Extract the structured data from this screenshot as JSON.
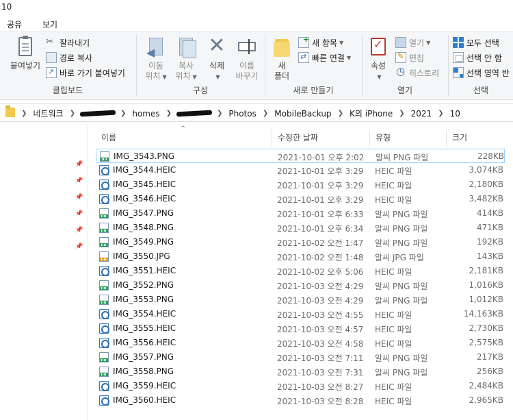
{
  "window": {
    "title": "10"
  },
  "menu": {
    "tabs": [
      "공유",
      "보기"
    ]
  },
  "ribbon": {
    "clipboard": {
      "label": "클립보드",
      "paste": "붙여넣기",
      "cut": "잘라내기",
      "copy_path": "경로 복사",
      "paste_shortcut": "바로 가기 붙여넣기"
    },
    "organize": {
      "label": "구성",
      "move_to": [
        "이동",
        "위치"
      ],
      "copy_to": [
        "복사",
        "위치"
      ],
      "delete": "삭제",
      "rename": [
        "이름",
        "바꾸기"
      ]
    },
    "new": {
      "label": "새로 만들기",
      "new_folder": [
        "새",
        "폴더"
      ],
      "new_item": "새 항목",
      "easy_access": "빠른 연결"
    },
    "open": {
      "label": "열기",
      "properties": "속성",
      "open": "열기",
      "edit": "편집",
      "history": "히스토리"
    },
    "select": {
      "label": "선택",
      "select_all": "모두 선택",
      "select_none": "선택 안 함",
      "invert": "선택 영역 반"
    }
  },
  "address": {
    "crumbs": [
      "네트워크",
      "homes",
      "Photos",
      "MobileBackup",
      "K의 iPhone",
      "2021",
      "10"
    ]
  },
  "columns": {
    "name": "이름",
    "date": "수정한 날짜",
    "type": "유형",
    "size": "크기"
  },
  "files": [
    {
      "name": "IMG_3543.PNG",
      "date": "2021-10-01 오후 2:02",
      "type": "알씨 PNG 파일",
      "size": "228KB",
      "kind": "png"
    },
    {
      "name": "IMG_3544.HEIC",
      "date": "2021-10-01 오후 3:29",
      "type": "HEIC 파일",
      "size": "3,074KB",
      "kind": "heic"
    },
    {
      "name": "IMG_3545.HEIC",
      "date": "2021-10-01 오후 3:29",
      "type": "HEIC 파일",
      "size": "2,180KB",
      "kind": "heic"
    },
    {
      "name": "IMG_3546.HEIC",
      "date": "2021-10-01 오후 3:29",
      "type": "HEIC 파일",
      "size": "3,482KB",
      "kind": "heic"
    },
    {
      "name": "IMG_3547.PNG",
      "date": "2021-10-01 오후 6:33",
      "type": "알씨 PNG 파일",
      "size": "414KB",
      "kind": "png"
    },
    {
      "name": "IMG_3548.PNG",
      "date": "2021-10-01 오후 6:34",
      "type": "알씨 PNG 파일",
      "size": "471KB",
      "kind": "png"
    },
    {
      "name": "IMG_3549.PNG",
      "date": "2021-10-02 오전 1:47",
      "type": "알씨 PNG 파일",
      "size": "192KB",
      "kind": "png"
    },
    {
      "name": "IMG_3550.JPG",
      "date": "2021-10-02 오전 1:48",
      "type": "알씨 JPG 파일",
      "size": "143KB",
      "kind": "jpg"
    },
    {
      "name": "IMG_3551.HEIC",
      "date": "2021-10-02 오후 5:06",
      "type": "HEIC 파일",
      "size": "2,181KB",
      "kind": "heic"
    },
    {
      "name": "IMG_3552.PNG",
      "date": "2021-10-03 오전 4:29",
      "type": "알씨 PNG 파일",
      "size": "1,016KB",
      "kind": "png"
    },
    {
      "name": "IMG_3553.PNG",
      "date": "2021-10-03 오전 4:29",
      "type": "알씨 PNG 파일",
      "size": "1,012KB",
      "kind": "png"
    },
    {
      "name": "IMG_3554.HEIC",
      "date": "2021-10-03 오전 4:55",
      "type": "HEIC 파일",
      "size": "14,163KB",
      "kind": "heic"
    },
    {
      "name": "IMG_3555.HEIC",
      "date": "2021-10-03 오전 4:57",
      "type": "HEIC 파일",
      "size": "2,730KB",
      "kind": "heic"
    },
    {
      "name": "IMG_3556.HEIC",
      "date": "2021-10-03 오전 4:58",
      "type": "HEIC 파일",
      "size": "2,575KB",
      "kind": "heic"
    },
    {
      "name": "IMG_3557.PNG",
      "date": "2021-10-03 오전 7:11",
      "type": "알씨 PNG 파일",
      "size": "217KB",
      "kind": "png"
    },
    {
      "name": "IMG_3558.PNG",
      "date": "2021-10-03 오전 7:31",
      "type": "알씨 PNG 파일",
      "size": "256KB",
      "kind": "png"
    },
    {
      "name": "IMG_3559.HEIC",
      "date": "2021-10-03 오전 8:27",
      "type": "HEIC 파일",
      "size": "2,484KB",
      "kind": "heic"
    },
    {
      "name": "IMG_3560.HEIC",
      "date": "2021-10-03 오전 8:28",
      "type": "HEIC 파일",
      "size": "2,965KB",
      "kind": "heic"
    }
  ],
  "colors": {
    "focus_border": "#99d1ff",
    "folder": "#f2c94c",
    "png_icon": "#2f9e5f",
    "jpg_icon": "#e29b22",
    "heic_icon": "#2f6fad"
  }
}
